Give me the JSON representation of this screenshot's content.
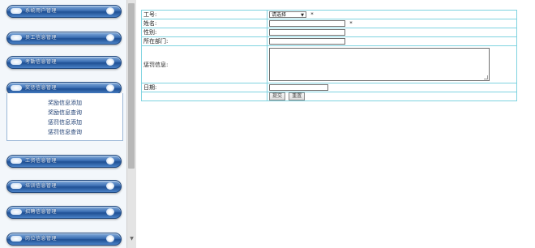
{
  "sidebar": {
    "nav": [
      {
        "label": "系统用户管理"
      },
      {
        "label": "员工信息管理"
      },
      {
        "label": "考勤信息管理"
      },
      {
        "label": "奖惩信息管理"
      },
      {
        "label": "工资信息管理"
      },
      {
        "label": "培训信息管理"
      },
      {
        "label": "招聘信息管理"
      },
      {
        "label": "岗位信息管理"
      }
    ],
    "subitems": [
      {
        "label": "奖励信息添加"
      },
      {
        "label": "奖励信息查询"
      },
      {
        "label": "惩罚信息添加"
      },
      {
        "label": "惩罚信息查询"
      }
    ]
  },
  "form": {
    "emp_no_label": "工号:",
    "emp_no_select": "请选择",
    "required_mark": "*",
    "name_label": "姓名:",
    "name_value": "",
    "gender_label": "性别:",
    "gender_value": "",
    "dept_label": "所在部门:",
    "dept_value": "",
    "penalty_label": "惩罚信息:",
    "penalty_value": "",
    "date_label": "日期:",
    "date_value": "",
    "submit_label": "提交",
    "reset_label": "重置"
  }
}
